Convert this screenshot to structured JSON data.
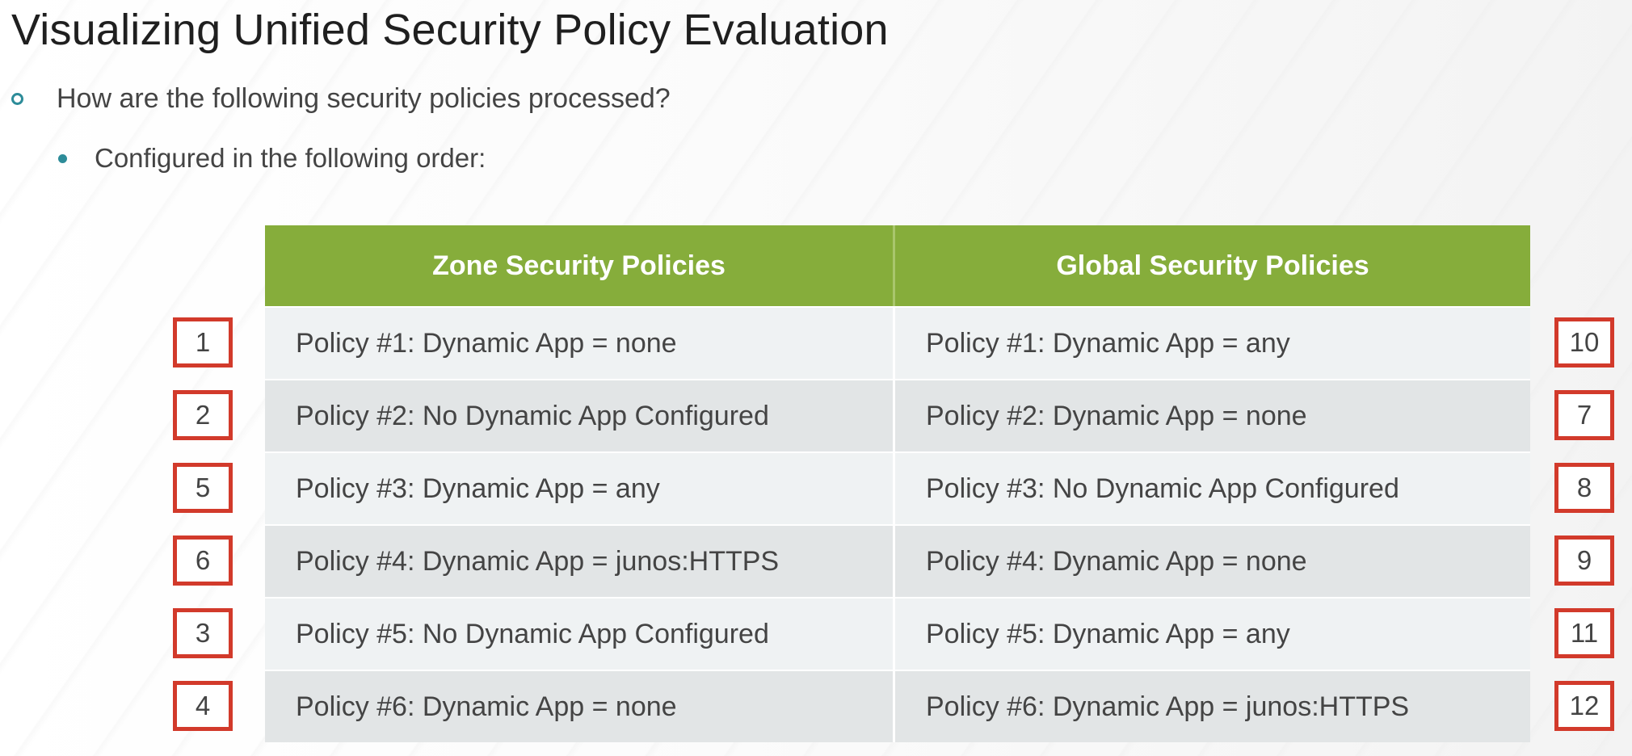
{
  "title": "Visualizing Unified Security Policy Evaluation",
  "bullets": {
    "level1": "How are the following security policies processed?",
    "level2": "Configured in the following order:"
  },
  "table": {
    "headers": {
      "zone": "Zone Security Policies",
      "global": "Global Security Policies"
    },
    "rows": [
      {
        "zone": "Policy #1: Dynamic App = none",
        "global": "Policy #1: Dynamic App = any",
        "left_order": "1",
        "right_order": "10"
      },
      {
        "zone": "Policy #2: No Dynamic App Configured",
        "global": "Policy #2: Dynamic App = none",
        "left_order": "2",
        "right_order": "7"
      },
      {
        "zone": "Policy #3: Dynamic App = any",
        "global": "Policy #3: No Dynamic App Configured",
        "left_order": "5",
        "right_order": "8"
      },
      {
        "zone": "Policy #4: Dynamic App = junos:HTTPS",
        "global": "Policy #4: Dynamic App = none",
        "left_order": "6",
        "right_order": "9"
      },
      {
        "zone": "Policy #5: No Dynamic App Configured",
        "global": "Policy #5: Dynamic App = any",
        "left_order": "3",
        "right_order": "11"
      },
      {
        "zone": "Policy #6: Dynamic App = none",
        "global": "Policy #6: Dynamic App = junos:HTTPS",
        "left_order": "4",
        "right_order": "12"
      }
    ]
  },
  "colors": {
    "header_green": "#86ad3b",
    "order_box_red": "#d23a2b",
    "bullet_teal": "#2d8c99"
  }
}
